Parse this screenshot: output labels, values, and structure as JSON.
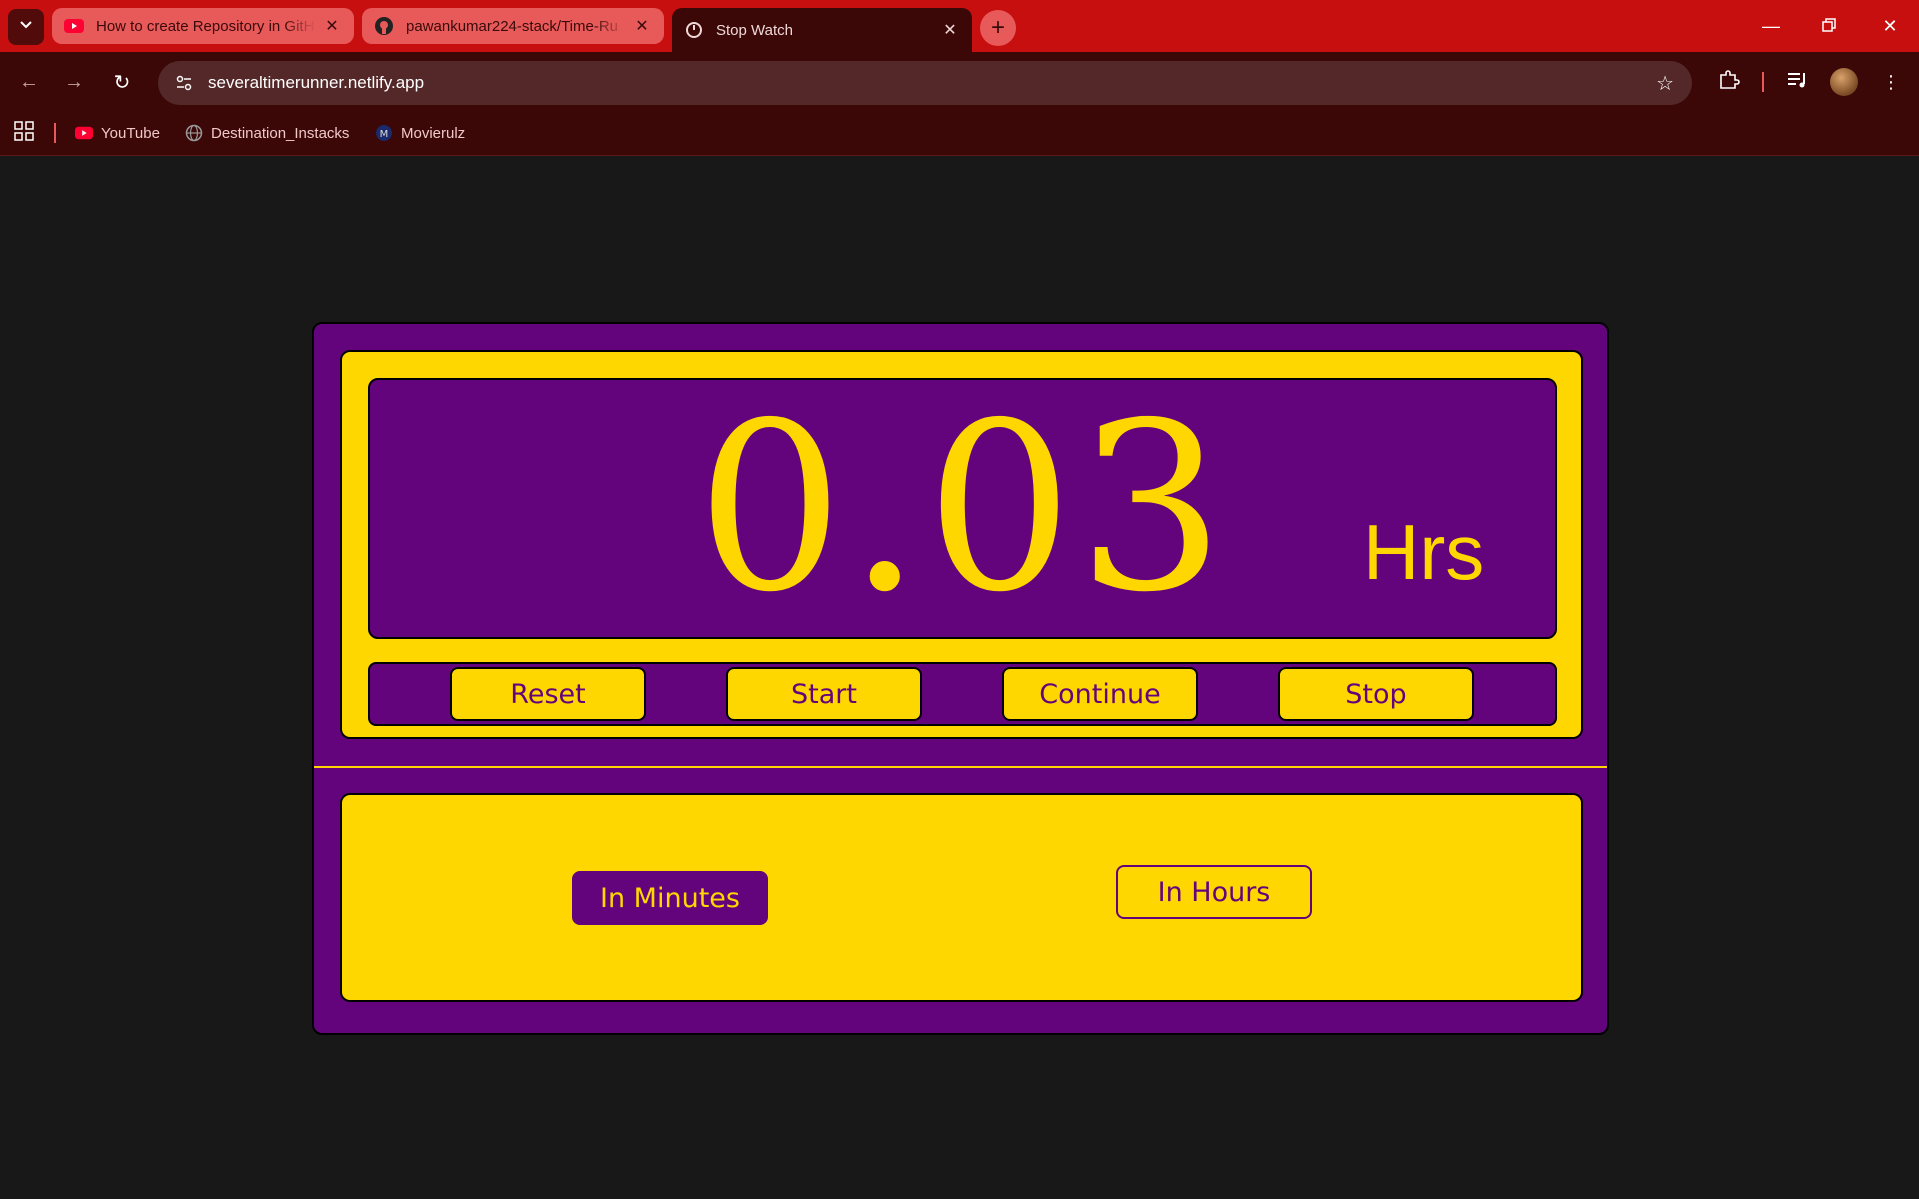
{
  "browser": {
    "tabs": [
      {
        "title": "How to create Repository in GitH",
        "icon": "youtube-icon",
        "active": false
      },
      {
        "title": "pawankumar224-stack/Time-Ru",
        "icon": "github-icon",
        "active": false
      },
      {
        "title": "Stop Watch",
        "icon": "favicon-icon",
        "active": true
      }
    ],
    "url": "severaltimerunner.netlify.app",
    "bookmarks": [
      {
        "label": "YouTube",
        "icon": "youtube-icon"
      },
      {
        "label": "Destination_Instacks",
        "icon": "globe-icon"
      },
      {
        "label": "Movierulz",
        "icon": "movierulz-icon"
      }
    ]
  },
  "stopwatch": {
    "time_value": "0.03",
    "unit": "Hrs",
    "controls": {
      "reset": "Reset",
      "start": "Start",
      "continue": "Continue",
      "stop": "Stop"
    },
    "modes": {
      "minutes": "In Minutes",
      "hours": "In Hours",
      "selected": "minutes"
    }
  },
  "colors": {
    "purple": "#63047c",
    "yellow": "#ffd700",
    "chrome_red": "#c80f0f",
    "chrome_dark": "#3b0707"
  }
}
